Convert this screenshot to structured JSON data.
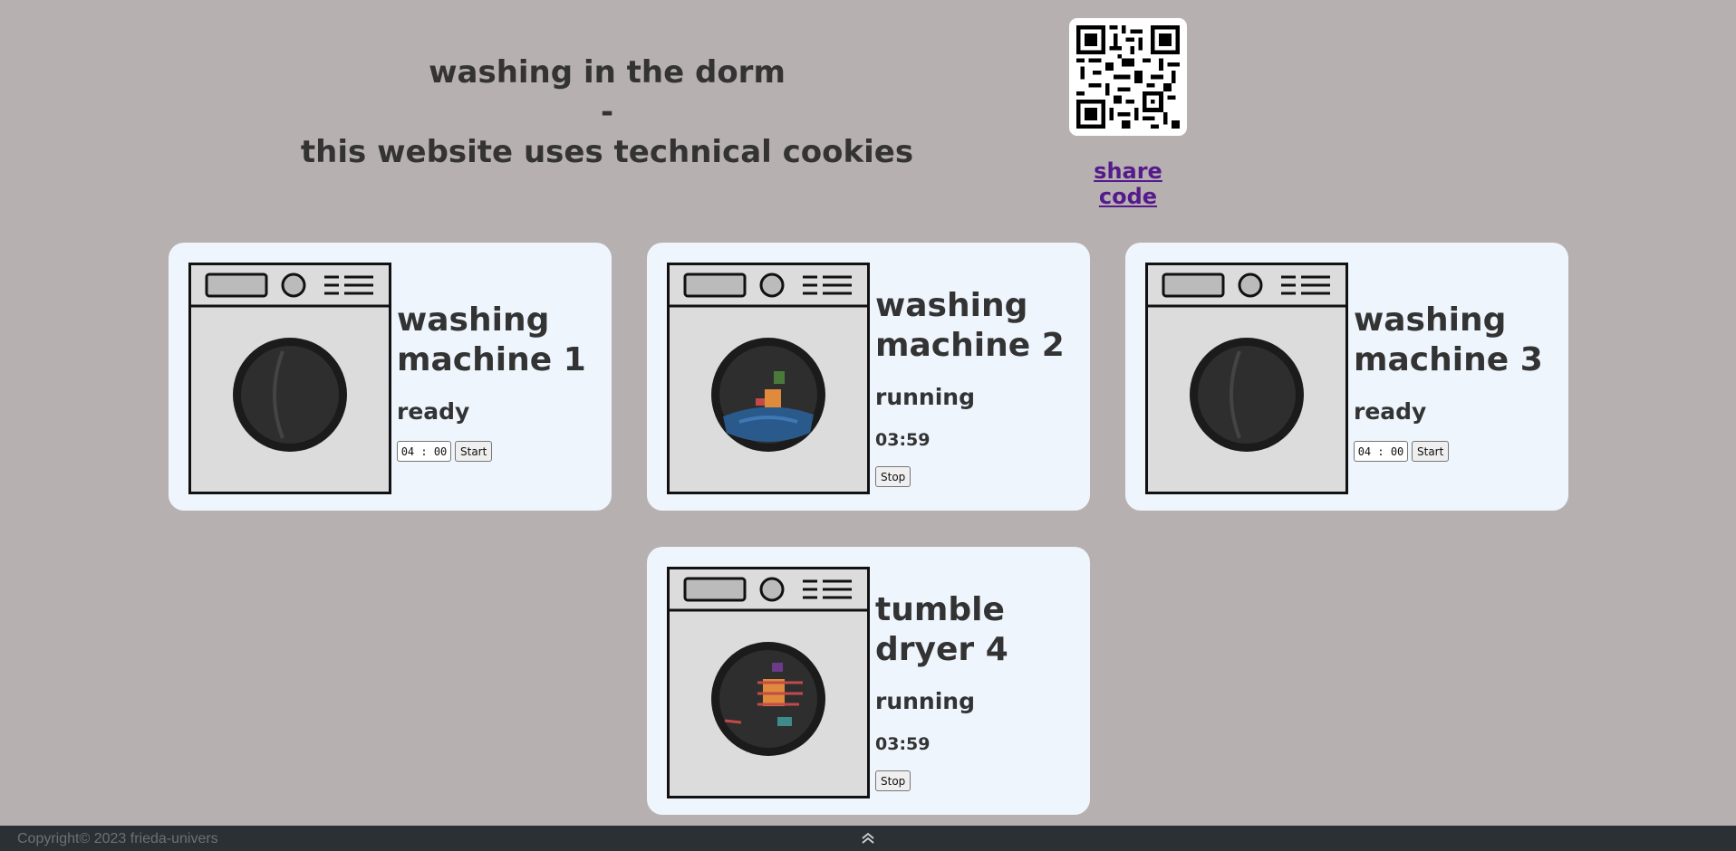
{
  "header": {
    "line1": "washing in the dorm",
    "line2": "-",
    "line3": "this website uses technical cookies"
  },
  "share": {
    "link_text": "share code",
    "qr_icon": "qr-code-icon"
  },
  "machines": [
    {
      "name": "washing machine 1",
      "status": "ready",
      "time_value": "04 : 00",
      "button": "Start",
      "drum": "empty"
    },
    {
      "name": "washing machine 2",
      "status": "running",
      "time": "03:59",
      "button": "Stop",
      "drum": "washing"
    },
    {
      "name": "washing machine 3",
      "status": "ready",
      "time_value": "04 : 00",
      "button": "Start",
      "drum": "empty"
    },
    {
      "name": "tumble dryer 4",
      "status": "running",
      "time": "03:59",
      "button": "Stop",
      "drum": "drying"
    }
  ],
  "footer": {
    "copyright": "Copyright© 2023 frieda-univers",
    "scroll_top_icon": "double-chevron-up-icon"
  },
  "colors": {
    "background": "#b7b0b0",
    "card": "#eef5fd",
    "footer": "#2b3035",
    "link": "#551a8b"
  }
}
